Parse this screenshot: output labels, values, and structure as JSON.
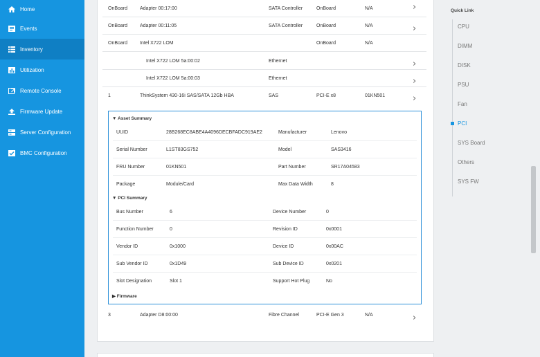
{
  "sidebar": {
    "items": [
      {
        "label": "Home",
        "icon": "home-icon"
      },
      {
        "label": "Events",
        "icon": "events-icon"
      },
      {
        "label": "Inventory",
        "icon": "inventory-icon"
      },
      {
        "label": "Utilization",
        "icon": "utilization-icon"
      },
      {
        "label": "Remote Console",
        "icon": "remote-console-icon"
      },
      {
        "label": "Firmware Update",
        "icon": "firmware-update-icon"
      },
      {
        "label": "Server Configuration",
        "icon": "server-configuration-icon"
      },
      {
        "label": "BMC Configuration",
        "icon": "bmc-configuration-icon"
      }
    ],
    "active_color": "#0f7fc4",
    "bg_color": "#1695e0"
  },
  "rows": [
    {
      "slot": "OnBoard",
      "name": "Adapter 00:17:00",
      "type": "SATA Controller",
      "location": "OnBoard",
      "fru": "N/A",
      "expandable": true
    },
    {
      "slot": "OnBoard",
      "name": "Adapter 00:11:05",
      "type": "SATA Controller",
      "location": "OnBoard",
      "fru": "N/A",
      "expandable": true
    },
    {
      "slot": "OnBoard",
      "name": "Intel X722 LOM",
      "type": "",
      "location": "OnBoard",
      "fru": "N/A",
      "expandable": false
    },
    {
      "slot": "",
      "name": "Intel X722 LOM 5a:00:02",
      "type": "Ethernet",
      "location": "",
      "fru": "",
      "expandable": true
    },
    {
      "slot": "",
      "name": "Intel X722 LOM 5a:00:03",
      "type": "Ethernet",
      "location": "",
      "fru": "",
      "expandable": true
    },
    {
      "slot": "1",
      "name": "ThinkSystem 430-16i SAS/SATA 12Gb HBA",
      "type": "SAS",
      "location": "PCI-E x8",
      "fru": "01KN501",
      "expandable": true
    },
    {
      "slot": "3",
      "name": "Adapter D8:00:00",
      "type": "Fibre Channel",
      "location": "PCI-E Gen 3",
      "fru": "N/A",
      "expandable": true
    }
  ],
  "detail": {
    "asset_title": "▼ Asset Summary",
    "asset": {
      "uuid_label": "UUID",
      "uuid": "28B268EC8ABE4A4096DECBFADC919AE2",
      "manufacturer_label": "Manufacturer",
      "manufacturer": "Lenovo",
      "serial_label": "Serial Number",
      "serial": "L1ST83GS752",
      "model_label": "Model",
      "model": "SAS3416",
      "fru_label": "FRU Number",
      "fru": "01KN501",
      "part_label": "Part Number",
      "part": "SR17A04583",
      "package_label": "Package",
      "package": "Module/Card",
      "width_label": "Max Data Width",
      "width": "8"
    },
    "pci_title": "▼ PCI Summary",
    "pci": {
      "bus_label": "Bus Number",
      "bus": "6",
      "device_label": "Device Number",
      "device": "0",
      "function_label": "Function Number",
      "function": "0",
      "revision_label": "Revision ID",
      "revision": "0x0001",
      "vendor_label": "Vendor ID",
      "vendor": "0x1000",
      "device_id_label": "Device ID",
      "device_id": "0x00AC",
      "sub_vendor_label": "Sub Vendor ID",
      "sub_vendor": "0x1D49",
      "sub_device_label": "Sub Device ID",
      "sub_device": "0x0201",
      "slot_label": "Slot Designation",
      "slot": "Slot 1",
      "hotplug_label": "Support Hot Plug",
      "hotplug": "No"
    },
    "firmware_title": "▶ Firmware"
  },
  "quick_link": {
    "title": "Quick Link",
    "items": [
      "CPU",
      "DIMM",
      "DISK",
      "PSU",
      "Fan",
      "PCI",
      "SYS Board",
      "Others",
      "SYS FW"
    ],
    "active": "PCI",
    "accent": "#1695e0"
  },
  "chevron": "›"
}
